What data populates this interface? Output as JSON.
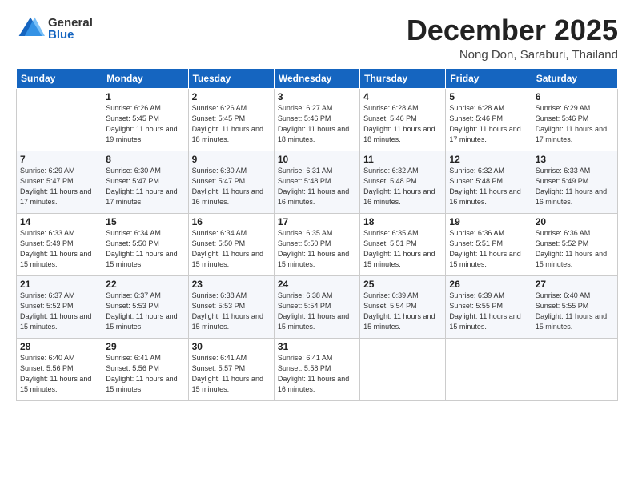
{
  "header": {
    "logo_general": "General",
    "logo_blue": "Blue",
    "month_title": "December 2025",
    "location": "Nong Don, Saraburi, Thailand"
  },
  "days_of_week": [
    "Sunday",
    "Monday",
    "Tuesday",
    "Wednesday",
    "Thursday",
    "Friday",
    "Saturday"
  ],
  "weeks": [
    [
      {
        "day": "",
        "info": ""
      },
      {
        "day": "1",
        "info": "Sunrise: 6:26 AM\nSunset: 5:45 PM\nDaylight: 11 hours\nand 19 minutes."
      },
      {
        "day": "2",
        "info": "Sunrise: 6:26 AM\nSunset: 5:45 PM\nDaylight: 11 hours\nand 18 minutes."
      },
      {
        "day": "3",
        "info": "Sunrise: 6:27 AM\nSunset: 5:46 PM\nDaylight: 11 hours\nand 18 minutes."
      },
      {
        "day": "4",
        "info": "Sunrise: 6:28 AM\nSunset: 5:46 PM\nDaylight: 11 hours\nand 18 minutes."
      },
      {
        "day": "5",
        "info": "Sunrise: 6:28 AM\nSunset: 5:46 PM\nDaylight: 11 hours\nand 17 minutes."
      },
      {
        "day": "6",
        "info": "Sunrise: 6:29 AM\nSunset: 5:46 PM\nDaylight: 11 hours\nand 17 minutes."
      }
    ],
    [
      {
        "day": "7",
        "info": "Sunrise: 6:29 AM\nSunset: 5:47 PM\nDaylight: 11 hours\nand 17 minutes."
      },
      {
        "day": "8",
        "info": "Sunrise: 6:30 AM\nSunset: 5:47 PM\nDaylight: 11 hours\nand 17 minutes."
      },
      {
        "day": "9",
        "info": "Sunrise: 6:30 AM\nSunset: 5:47 PM\nDaylight: 11 hours\nand 16 minutes."
      },
      {
        "day": "10",
        "info": "Sunrise: 6:31 AM\nSunset: 5:48 PM\nDaylight: 11 hours\nand 16 minutes."
      },
      {
        "day": "11",
        "info": "Sunrise: 6:32 AM\nSunset: 5:48 PM\nDaylight: 11 hours\nand 16 minutes."
      },
      {
        "day": "12",
        "info": "Sunrise: 6:32 AM\nSunset: 5:48 PM\nDaylight: 11 hours\nand 16 minutes."
      },
      {
        "day": "13",
        "info": "Sunrise: 6:33 AM\nSunset: 5:49 PM\nDaylight: 11 hours\nand 16 minutes."
      }
    ],
    [
      {
        "day": "14",
        "info": "Sunrise: 6:33 AM\nSunset: 5:49 PM\nDaylight: 11 hours\nand 15 minutes."
      },
      {
        "day": "15",
        "info": "Sunrise: 6:34 AM\nSunset: 5:50 PM\nDaylight: 11 hours\nand 15 minutes."
      },
      {
        "day": "16",
        "info": "Sunrise: 6:34 AM\nSunset: 5:50 PM\nDaylight: 11 hours\nand 15 minutes."
      },
      {
        "day": "17",
        "info": "Sunrise: 6:35 AM\nSunset: 5:50 PM\nDaylight: 11 hours\nand 15 minutes."
      },
      {
        "day": "18",
        "info": "Sunrise: 6:35 AM\nSunset: 5:51 PM\nDaylight: 11 hours\nand 15 minutes."
      },
      {
        "day": "19",
        "info": "Sunrise: 6:36 AM\nSunset: 5:51 PM\nDaylight: 11 hours\nand 15 minutes."
      },
      {
        "day": "20",
        "info": "Sunrise: 6:36 AM\nSunset: 5:52 PM\nDaylight: 11 hours\nand 15 minutes."
      }
    ],
    [
      {
        "day": "21",
        "info": "Sunrise: 6:37 AM\nSunset: 5:52 PM\nDaylight: 11 hours\nand 15 minutes."
      },
      {
        "day": "22",
        "info": "Sunrise: 6:37 AM\nSunset: 5:53 PM\nDaylight: 11 hours\nand 15 minutes."
      },
      {
        "day": "23",
        "info": "Sunrise: 6:38 AM\nSunset: 5:53 PM\nDaylight: 11 hours\nand 15 minutes."
      },
      {
        "day": "24",
        "info": "Sunrise: 6:38 AM\nSunset: 5:54 PM\nDaylight: 11 hours\nand 15 minutes."
      },
      {
        "day": "25",
        "info": "Sunrise: 6:39 AM\nSunset: 5:54 PM\nDaylight: 11 hours\nand 15 minutes."
      },
      {
        "day": "26",
        "info": "Sunrise: 6:39 AM\nSunset: 5:55 PM\nDaylight: 11 hours\nand 15 minutes."
      },
      {
        "day": "27",
        "info": "Sunrise: 6:40 AM\nSunset: 5:55 PM\nDaylight: 11 hours\nand 15 minutes."
      }
    ],
    [
      {
        "day": "28",
        "info": "Sunrise: 6:40 AM\nSunset: 5:56 PM\nDaylight: 11 hours\nand 15 minutes."
      },
      {
        "day": "29",
        "info": "Sunrise: 6:41 AM\nSunset: 5:56 PM\nDaylight: 11 hours\nand 15 minutes."
      },
      {
        "day": "30",
        "info": "Sunrise: 6:41 AM\nSunset: 5:57 PM\nDaylight: 11 hours\nand 15 minutes."
      },
      {
        "day": "31",
        "info": "Sunrise: 6:41 AM\nSunset: 5:58 PM\nDaylight: 11 hours\nand 16 minutes."
      },
      {
        "day": "",
        "info": ""
      },
      {
        "day": "",
        "info": ""
      },
      {
        "day": "",
        "info": ""
      }
    ]
  ]
}
